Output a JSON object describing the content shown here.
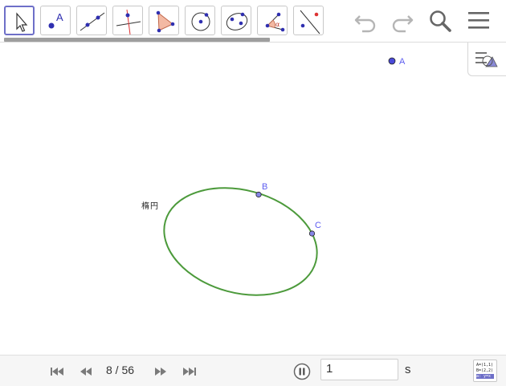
{
  "toolbar": {
    "tools": [
      {
        "icon": "move-arrow-icon",
        "selected": true
      },
      {
        "icon": "point-icon",
        "label": "A"
      },
      {
        "icon": "line-icon"
      },
      {
        "icon": "perpendicular-line-icon"
      },
      {
        "icon": "polygon-icon"
      },
      {
        "icon": "circle-with-center-icon"
      },
      {
        "icon": "ellipse-icon"
      },
      {
        "icon": "angle-icon"
      },
      {
        "icon": "reflect-about-line-icon"
      }
    ],
    "undo_icon": "undo-icon",
    "redo_icon": "redo-icon",
    "search_icon": "magnifier-icon",
    "menu_icon": "hamburger-menu-icon"
  },
  "canvas": {
    "point_a_label": "A",
    "point_b_label": "B",
    "point_c_label": "C",
    "ellipse_caption": "楕円",
    "ellipse_color": "#4c9a3b",
    "point_color": "#4a4ad8"
  },
  "bottom_bar": {
    "slide_counter": "8 / 56",
    "speed_value": "1",
    "speed_unit": "s",
    "algebra_rows": [
      "A=(1,1)",
      "B=(2,2)",
      "a: y=x"
    ]
  },
  "colors": {
    "accent": "#6e6fc8",
    "label_blue": "#5d5df0"
  }
}
